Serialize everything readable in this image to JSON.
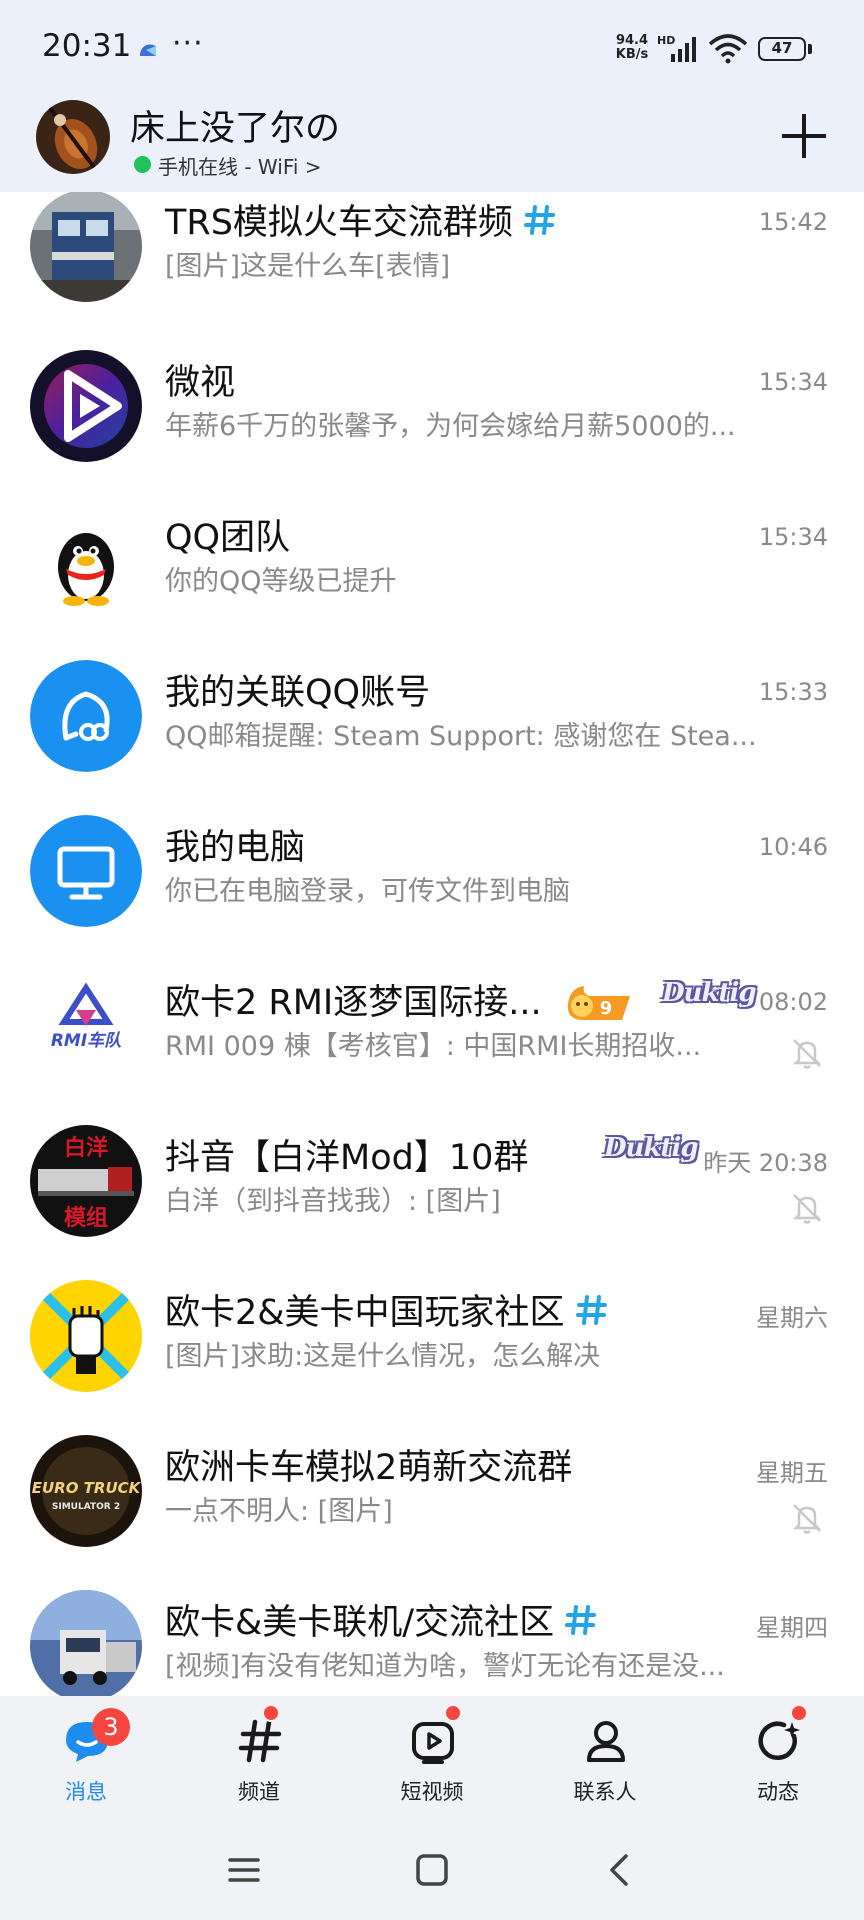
{
  "status_bar": {
    "time": "20:31",
    "dots": "···",
    "net_speed_value": "94.4",
    "net_speed_unit": "KB/s",
    "hd": "HD",
    "battery": "47"
  },
  "profile": {
    "name": "床上没了尔の",
    "online_status": "手机在线 - WiFi >",
    "add_icon": "plus-icon"
  },
  "chats": [
    {
      "title": "TRS模拟火车交流群频",
      "preview": "[图片]这是什么车[表情]",
      "time": "15:42",
      "is_channel": true
    },
    {
      "title": "微视",
      "preview": "年薪6千万的张馨予，为何会嫁给月薪5000的...",
      "time": "15:34"
    },
    {
      "title": "QQ团队",
      "preview": "你的QQ等级已提升",
      "time": "15:34"
    },
    {
      "title": "我的关联QQ账号",
      "preview": "QQ邮箱提醒: Steam Support: 感谢您在 Stea...",
      "time": "15:33"
    },
    {
      "title": "我的电脑",
      "preview": "你已在电脑登录，可传文件到电脑",
      "time": "10:46"
    },
    {
      "title": "欧卡2 RMI逐梦国际接...",
      "preview": "RMI 009 棟【考核官】: 中国RMI长期招收...",
      "time": "08:02",
      "muted": true,
      "fire_level": "9",
      "badge": "Duktig"
    },
    {
      "title": "抖音【白洋Mod】10群",
      "preview": "白洋（到抖音找我）: [图片]",
      "time": "昨天 20:38",
      "muted": true,
      "badge": "Duktig"
    },
    {
      "title": "欧卡2&美卡中国玩家社区",
      "preview": "[图片]求助:这是什么情况，怎么解决",
      "time": "星期六",
      "is_channel": true
    },
    {
      "title": "欧洲卡车模拟2萌新交流群",
      "preview": "一点不明人: [图片]",
      "time": "星期五",
      "muted": true
    },
    {
      "title": "欧卡&美卡联机/交流社区",
      "preview": "[视频]有没有佬知道为啥，警灯无论有还是没...",
      "time": "星期四",
      "is_channel": true
    }
  ],
  "avatar_text": {
    "rmi": "RMI车队",
    "baiyang_top": "白洋",
    "baiyang_bottom": "模组",
    "ets_line1": "EURO TRUCK",
    "ets_line2": "SIMULATOR 2"
  },
  "tabs": [
    {
      "label": "消息",
      "icon": "chat-bubble-icon",
      "badge": "3",
      "active": true
    },
    {
      "label": "频道",
      "icon": "hash-icon"
    },
    {
      "label": "短视频",
      "icon": "play-icon"
    },
    {
      "label": "联系人",
      "icon": "person-icon"
    },
    {
      "label": "动态",
      "icon": "refresh-star-icon"
    }
  ],
  "colors": {
    "accent": "#1f8cf0",
    "badge_red": "#f5463f",
    "online_green": "#20c25a",
    "header_bg": "#ebf0fa"
  }
}
